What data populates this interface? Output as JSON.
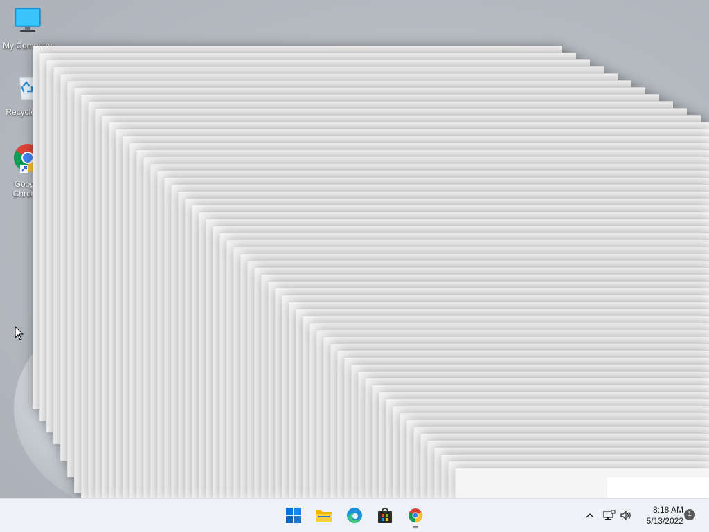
{
  "desktop": {
    "icons": [
      {
        "name": "my-computer-icon",
        "label": "My Computer"
      },
      {
        "name": "recycle-bin-icon",
        "label": "Recycle Bin"
      },
      {
        "name": "google-chrome-icon",
        "label": "Google\nChrome"
      }
    ]
  },
  "taskbar": {
    "apps": [
      {
        "name": "start-button-icon",
        "title": "Start",
        "running": false
      },
      {
        "name": "file-explorer-icon",
        "title": "File Explorer",
        "running": false
      },
      {
        "name": "edge-icon",
        "title": "Microsoft Edge",
        "running": false
      },
      {
        "name": "store-icon",
        "title": "Microsoft Store",
        "running": false
      },
      {
        "name": "chrome-icon",
        "title": "Google Chrome",
        "running": true
      }
    ],
    "tray": {
      "overflow_icon": "chevron-up-icon",
      "network_icon": "network-icon",
      "volume_icon": "volume-icon"
    },
    "clock": {
      "time": "8:18 AM",
      "date": "5/13/2022"
    },
    "notification_count": "1"
  }
}
